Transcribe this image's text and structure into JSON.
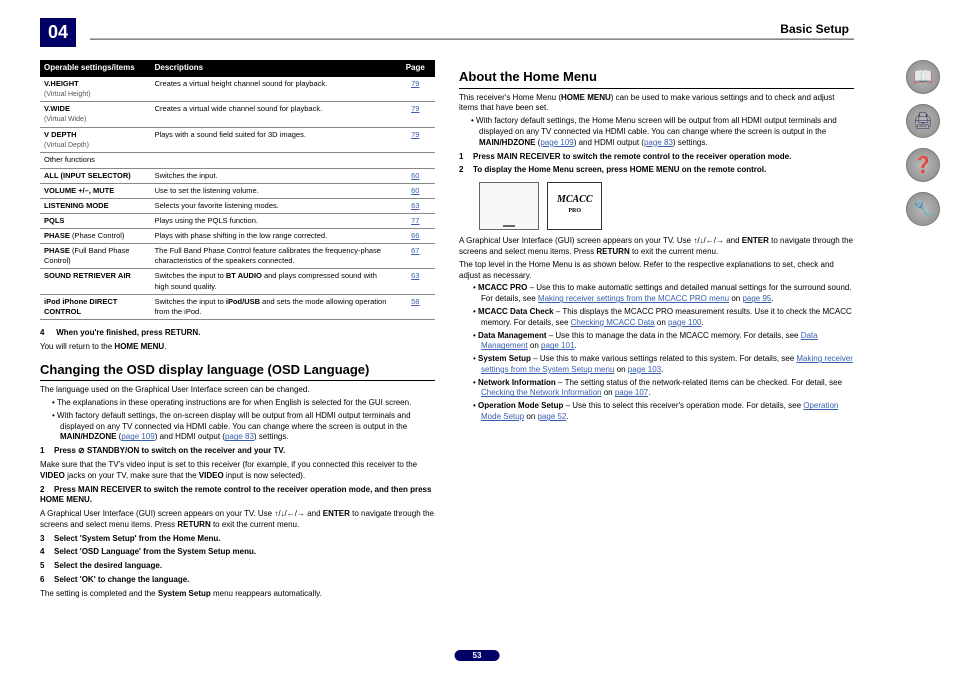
{
  "chapter": "04",
  "headerTitle": "Basic Setup",
  "pageNum": "53",
  "tableHeaders": {
    "col1": "Operable settings/items",
    "col2": "Descriptions",
    "col3": "Page"
  },
  "rows": [
    {
      "name": "V.HEIGHT",
      "sub": "(Virtual Height)",
      "desc": "Creates a virtual height channel sound for playback.",
      "page": "79",
      "indent": true
    },
    {
      "name": "V.WIDE",
      "sub": "(Virtual Wide)",
      "desc": "Creates a virtual wide channel sound for playback.",
      "page": "79",
      "indent": true
    },
    {
      "name": "V DEPTH",
      "sub": "(Virtual Depth)",
      "desc": "Plays with a sound field suited for 3D images.",
      "page": "79",
      "indent": true
    },
    {
      "name": "Other functions",
      "desc": "",
      "page": "",
      "plain": true
    },
    {
      "name": "ALL (INPUT SELECTOR)",
      "desc": "Switches the input.",
      "page": "60"
    },
    {
      "name": "VOLUME +/–, MUTE",
      "desc": "Use to set the listening volume.",
      "page": "60"
    },
    {
      "name": "LISTENING MODE",
      "desc": "Selects your favorite listening modes.",
      "page": "63"
    },
    {
      "name": "PQLS",
      "desc": "Plays using the PQLS function.",
      "page": "77"
    },
    {
      "name": "PHASE (Phase Control)",
      "nameExtra": "(Phase Control)",
      "desc": "Plays with phase shifting in the low range corrected.",
      "page": "66"
    },
    {
      "name": "PHASE (Full Band Phase Control)",
      "nameExtra": "(Full Band Phase Control)",
      "desc": "The Full Band Phase Control feature calibrates the frequency-phase characteristics of the speakers connected.",
      "page": "67"
    },
    {
      "name": "SOUND RETRIEVER AIR",
      "desc": "Switches the input to BT AUDIO and plays compressed sound with high sound quality.",
      "descBold": "BT AUDIO",
      "page": "63"
    },
    {
      "name": "iPod iPhone DIRECT CONTROL",
      "desc": "Switches the input to iPod/USB and sets the mode allowing operation from the iPod.",
      "descBold": "iPod/USB",
      "page": "58"
    }
  ],
  "postTable": {
    "step4": "When you're finished, press RETURN.",
    "step4num": "4",
    "returnNote1": "You will return to the ",
    "returnNote2": "HOME MENU",
    "returnNote3": "."
  },
  "osd": {
    "title": "Changing the OSD display language (OSD Language)",
    "intro": "The language used on the Graphical User Interface screen can be changed.",
    "b1": "The explanations in these operating instructions are for when English is selected for the GUI screen.",
    "b2a": "With factory default settings, the on-screen display will be output from all HDMI output terminals and displayed on any TV connected via HDMI cable. You can change where the screen is output in the ",
    "b2b": "MAIN/HDZONE",
    "b2c": " (",
    "b2link1": "page 109",
    "b2d": ") and HDMI output (",
    "b2link2": "page 83",
    "b2e": ") settings.",
    "s1num": "1",
    "s1": "Press ⊘ STANDBY/ON to switch on the receiver and your TV.",
    "s1note1": "Make sure that the TV's video input is set to this receiver (for example, if you connected this receiver to the ",
    "s1note2": "VIDEO",
    "s1note3": " jacks on your TV, make sure that the ",
    "s1note4": "VIDEO",
    "s1note5": " input is now selected).",
    "s2num": "2",
    "s2": "Press MAIN RECEIVER to switch the remote control to the receiver operation mode, and then press HOME MENU.",
    "s2note1": "A Graphical User Interface (GUI) screen appears on your TV. Use ",
    "s2arrows": "↑/↓/←/→",
    "s2note2": " and ",
    "s2enter": "ENTER",
    "s2note3": " to navigate through the screens and select menu items. Press ",
    "s2return": "RETURN",
    "s2note4": " to exit the current menu.",
    "s3num": "3",
    "s3": "Select 'System Setup' from the Home Menu.",
    "s4num": "4",
    "s4": "Select 'OSD Language' from the System Setup menu.",
    "s5num": "5",
    "s5": "Select the desired language.",
    "s6num": "6",
    "s6": "Select 'OK' to change the language.",
    "s6note1": "The setting is completed and the ",
    "s6note2": "System Setup",
    "s6note3": " menu reappears automatically."
  },
  "home": {
    "title": "About the Home Menu",
    "intro1": "This receiver's Home Menu (",
    "intro2": "HOME MENU",
    "intro3": ") can be used to make various settings and to check and adjust items that have been set.",
    "b1a": "With factory default settings, the Home Menu screen will be output from all HDMI output terminals and displayed on any TV connected via HDMI cable. You can change where the screen is output in the ",
    "b1b": "MAIN/HDZONE",
    "b1c": " (",
    "b1l1": "page 109",
    "b1d": ") and HDMI output (",
    "b1l2": "page 83",
    "b1e": ") settings.",
    "s1num": "1",
    "s1": "Press MAIN RECEIVER to switch the remote control to the receiver operation mode.",
    "s2num": "2",
    "s2": "To display the Home Menu screen, press HOME MENU on the remote control.",
    "logo": "MCACC",
    "logoSub": "PRO",
    "guiNote1": "A Graphical User Interface (GUI) screen appears on your TV. Use ",
    "guiArrows": "↑/↓/←/→",
    "guiNote2": " and ",
    "guiEnter": "ENTER",
    "guiNote3": " to navigate through the screens and select menu items. Press ",
    "guiReturn": "RETURN",
    "guiNote4": " to exit the current menu.",
    "topNote": "The top level in the Home Menu is as shown below. Refer to the respective explanations to set, check and adjust as necessary.",
    "items": [
      {
        "name": "MCACC PRO",
        "desc": " – Use this to make automatic settings and detailed manual settings for the surround sound. For details, see ",
        "link": "Making receiver settings from the MCACC PRO menu",
        "on": " on ",
        "page": "page 95",
        "end": "."
      },
      {
        "name": "MCACC Data Check",
        "desc": " – This displays the MCACC PRO measurement results. Use it to check the MCACC memory. For details, see ",
        "link": "Checking MCACC Data",
        "on": " on ",
        "page": "page 100",
        "end": "."
      },
      {
        "name": "Data Management",
        "desc": " – Use this to manage the data in the MCACC memory. For details, see ",
        "link": "Data Management",
        "on": " on ",
        "page": "page 101",
        "end": "."
      },
      {
        "name": "System Setup",
        "desc": " – Use this to make various settings related to this system. For details, see ",
        "link": "Making receiver settings from the System Setup menu",
        "on": " on ",
        "page": "page 103",
        "end": "."
      },
      {
        "name": "Network Information",
        "desc": " – The setting status of the network-related items can be checked. For detail, see ",
        "link": "Checking the Network Information",
        "on": " on ",
        "page": "page 107",
        "end": "."
      },
      {
        "name": "Operation Mode Setup",
        "desc": " – Use this to select this receiver's operation mode. For details, see ",
        "link": "Operation Mode Setup",
        "on": " on ",
        "page": "page 52",
        "end": "."
      }
    ]
  },
  "icons": {
    "i1": "📖",
    "i2": "🖨",
    "i3": "❓",
    "i4": "🔧"
  }
}
